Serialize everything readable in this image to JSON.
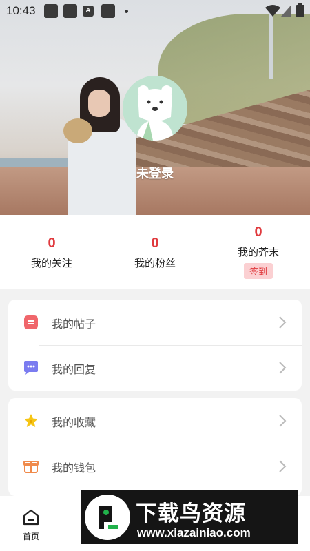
{
  "status": {
    "time": "10:43",
    "icon_a": "A"
  },
  "profile": {
    "login_text": "未登录"
  },
  "stats": [
    {
      "value": "0",
      "label": "我的关注"
    },
    {
      "value": "0",
      "label": "我的粉丝"
    },
    {
      "value": "0",
      "label": "我的芥末",
      "action": "签到"
    }
  ],
  "menu_card1": [
    {
      "label": "我的帖子",
      "icon": "post-icon"
    },
    {
      "label": "我的回复",
      "icon": "reply-icon"
    }
  ],
  "menu_card2": [
    {
      "label": "我的收藏",
      "icon": "star-icon"
    },
    {
      "label": "我的钱包",
      "icon": "wallet-icon"
    }
  ],
  "tabbar": {
    "home_label": "首页"
  },
  "watermark": {
    "title": "下载鸟资源",
    "url": "www.xiazainiao.com"
  },
  "colors": {
    "accent": "#e03a3e",
    "signin_bg": "#fbd0d2"
  }
}
